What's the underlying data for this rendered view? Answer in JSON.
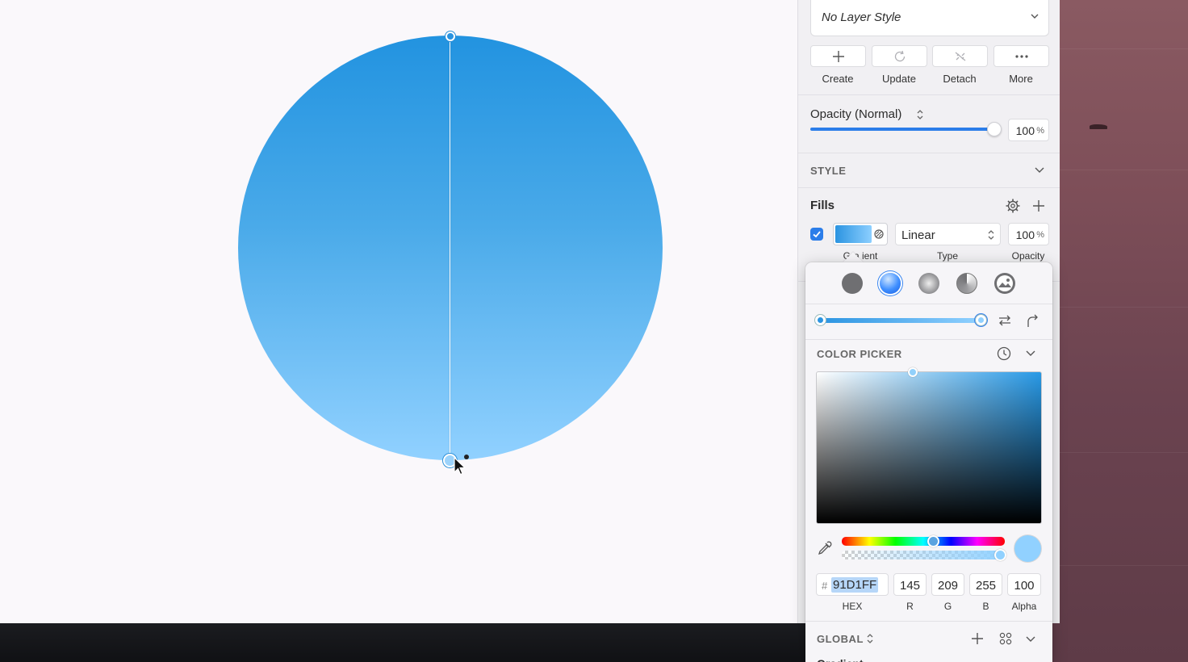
{
  "layer_style": {
    "value": "No Layer Style"
  },
  "style_actions": [
    {
      "label": "Create",
      "icon": "plus-icon"
    },
    {
      "label": "Update",
      "icon": "refresh-icon"
    },
    {
      "label": "Detach",
      "icon": "detach-icon"
    },
    {
      "label": "More",
      "icon": "ellipsis-icon"
    }
  ],
  "opacity": {
    "label": "Opacity (Normal)",
    "value": "100",
    "unit": "%",
    "level": 1.0
  },
  "style_section": {
    "heading": "STYLE"
  },
  "fills": {
    "heading": "Fills",
    "enabled": true,
    "type_value": "Linear",
    "opacity_value": "100",
    "opacity_unit": "%",
    "labels": {
      "gradient": "Gra ient",
      "type": "Type",
      "opacity": "Opacity"
    }
  },
  "color_picker": {
    "heading": "COLOR PICKER",
    "fill_types": [
      "solid-fill-icon",
      "linear-gradient-icon",
      "radial-gradient-icon",
      "angular-gradient-icon",
      "image-fill-icon"
    ],
    "selected_fill_type": "linear-gradient-icon",
    "gradient_stops": [
      "#2B94E1",
      "#91D1FF"
    ],
    "hex_prefix": "#",
    "hex": "91D1FF",
    "r": "145",
    "g": "209",
    "b": "255",
    "alpha": "100",
    "labels": {
      "hex": "HEX",
      "r": "R",
      "g": "G",
      "b": "B",
      "alpha": "Alpha"
    }
  },
  "global": {
    "heading": "GLOBAL",
    "next_heading": "Gradient"
  },
  "canvas": {
    "shape_gradient": [
      "#2293E0",
      "#91D1FF"
    ]
  }
}
